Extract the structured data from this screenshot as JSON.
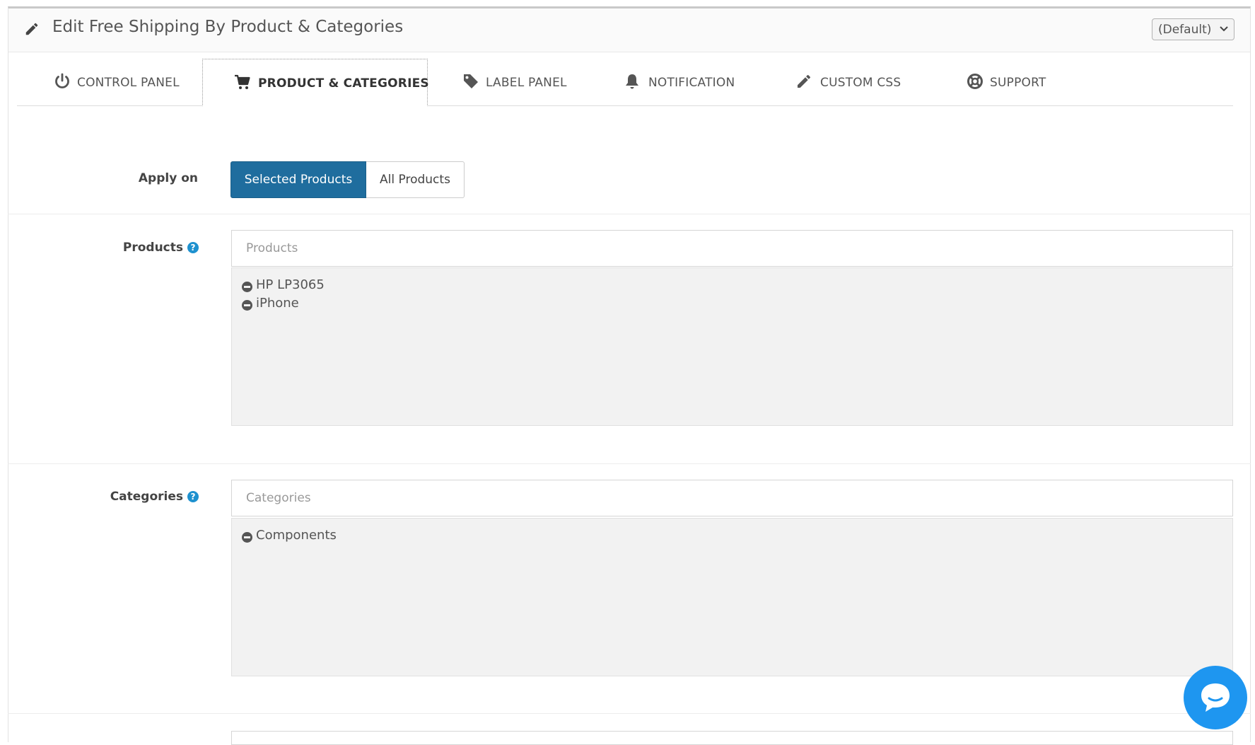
{
  "header": {
    "title": "Edit Free Shipping By Product & Categories",
    "store_select": "(Default)"
  },
  "tabs": [
    {
      "label": "CONTROL PANEL",
      "icon": "power-icon",
      "active": false
    },
    {
      "label": "PRODUCT & CATEGORIES",
      "icon": "cart-icon",
      "active": true
    },
    {
      "label": "LABEL PANEL",
      "icon": "tag-icon",
      "active": false
    },
    {
      "label": "NOTIFICATION",
      "icon": "bell-icon",
      "active": false
    },
    {
      "label": "CUSTOM CSS",
      "icon": "pencil-icon",
      "active": false
    },
    {
      "label": "SUPPORT",
      "icon": "life-ring-icon",
      "active": false
    }
  ],
  "apply_on": {
    "label": "Apply on",
    "options": [
      "Selected Products",
      "All Products"
    ],
    "selected": "Selected Products"
  },
  "products": {
    "label": "Products",
    "placeholder": "Products",
    "items": [
      "HP LP3065",
      "iPhone"
    ]
  },
  "categories": {
    "label": "Categories",
    "placeholder": "Categories",
    "items": [
      "Components"
    ]
  },
  "colors": {
    "primary_button": "#1f6d9e",
    "help_icon": "#1e91cf",
    "chat_button": "#1e96f0"
  }
}
